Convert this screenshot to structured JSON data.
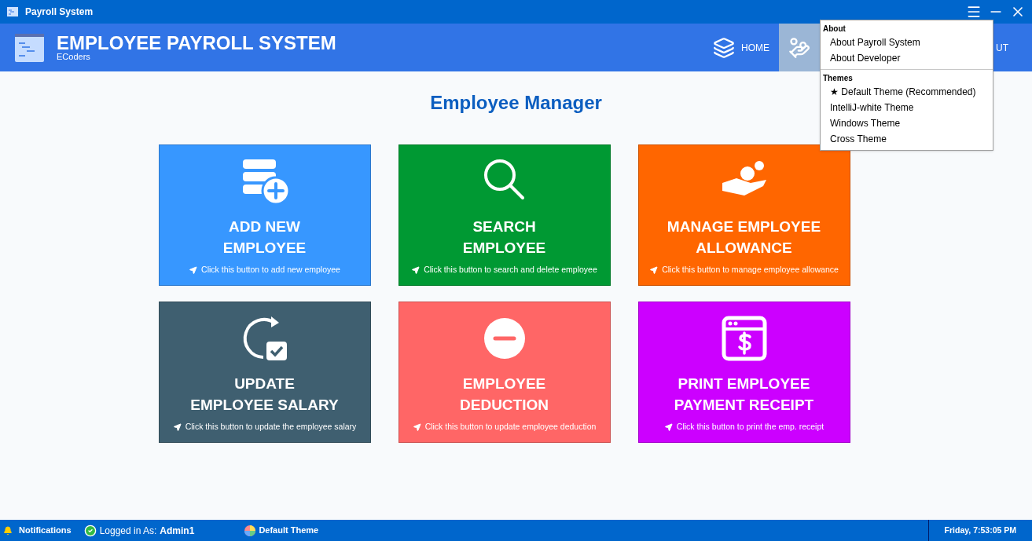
{
  "window": {
    "title": "Payroll System"
  },
  "header": {
    "title": "EMPLOYEE PAYROLL SYSTEM",
    "subtitle": "ECoders"
  },
  "nav": [
    {
      "kind": "home",
      "label": "HOME",
      "selected": false
    },
    {
      "kind": "manage",
      "selected": true
    },
    {
      "kind": "about",
      "label": "UT",
      "selected": false
    }
  ],
  "menu": {
    "sections": [
      {
        "heading": "About",
        "items": [
          "About Payroll System",
          "About Developer"
        ]
      },
      {
        "heading": "Themes",
        "items": [
          "★ Default Theme (Recommended)",
          "IntelliJ-white Theme",
          "Windows Theme",
          "Cross Theme"
        ]
      }
    ]
  },
  "page_title": "Employee Manager",
  "cards": [
    {
      "kind": "add",
      "title": [
        "ADD NEW",
        "EMPLOYEE"
      ],
      "hint": "Click this button to add new employee",
      "color": "#3797ff"
    },
    {
      "kind": "search",
      "title": [
        "SEARCH",
        "EMPLOYEE"
      ],
      "hint": "Click this button to search and delete employee",
      "color": "#009933"
    },
    {
      "kind": "allowance",
      "title": [
        "MANAGE EMPLOYEE",
        "ALLOWANCE"
      ],
      "hint": "Click this button to manage employee allowance",
      "color": "#ff6600"
    },
    {
      "kind": "update",
      "title": [
        "UPDATE",
        "EMPLOYEE SALARY"
      ],
      "hint": "Click this button to update the employee salary",
      "color": "#3f5f70"
    },
    {
      "kind": "deduction",
      "title": [
        "EMPLOYEE",
        "DEDUCTION"
      ],
      "hint": "Click this button to update employee deduction",
      "color": "#ff6666"
    },
    {
      "kind": "receipt",
      "title": [
        "PRINT EMPLOYEE",
        "PAYMENT RECEIPT"
      ],
      "hint": "Click this button to print the emp. receipt",
      "color": "#cc00ff"
    }
  ],
  "status_bar": {
    "notifications": "Notifications",
    "login_label": "Logged in As:",
    "user": "Admin1",
    "theme": "Default Theme",
    "clock": "Friday, 7:53:05 PM"
  }
}
